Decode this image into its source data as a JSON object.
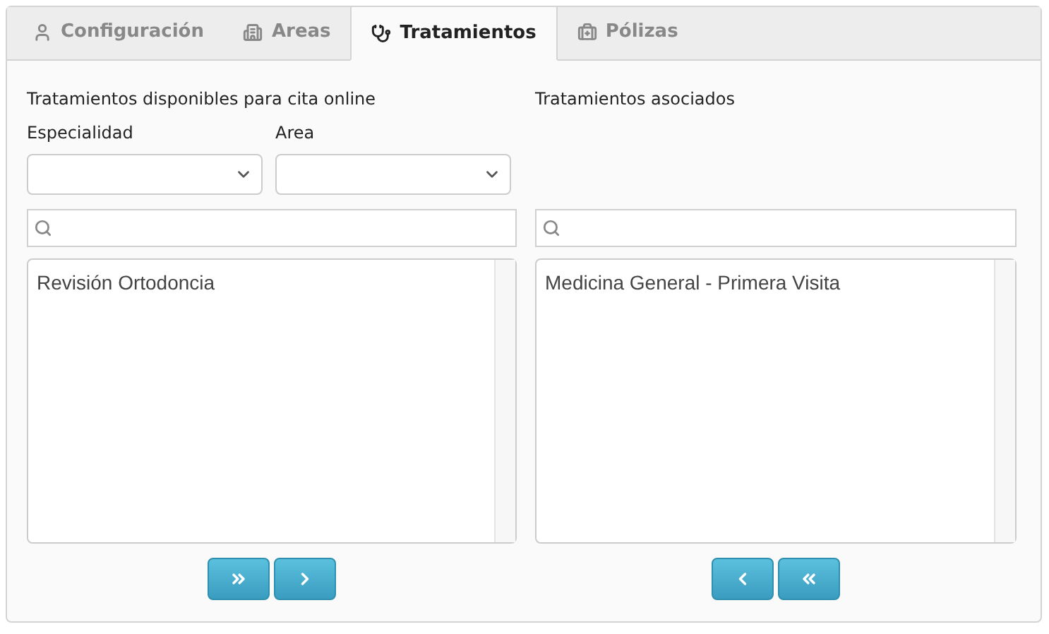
{
  "tabs": [
    {
      "label": "Configuración",
      "selected": false
    },
    {
      "label": "Areas",
      "selected": false
    },
    {
      "label": "Tratamientos",
      "selected": true
    },
    {
      "label": "Pólizas",
      "selected": false
    }
  ],
  "available": {
    "title": "Tratamientos disponibles para cita online",
    "filters": [
      {
        "label": "Especialidad"
      },
      {
        "label": "Area"
      }
    ],
    "items": [
      "Revisión Ortodoncia"
    ],
    "buttons": [
      {
        "kind": "move-all-right"
      },
      {
        "kind": "move-right"
      }
    ]
  },
  "associated": {
    "title": "Tratamientos asociados",
    "items": [
      "Medicina General - Primera Visita"
    ],
    "buttons": [
      {
        "kind": "move-left"
      },
      {
        "kind": "move-all-left"
      }
    ]
  }
}
